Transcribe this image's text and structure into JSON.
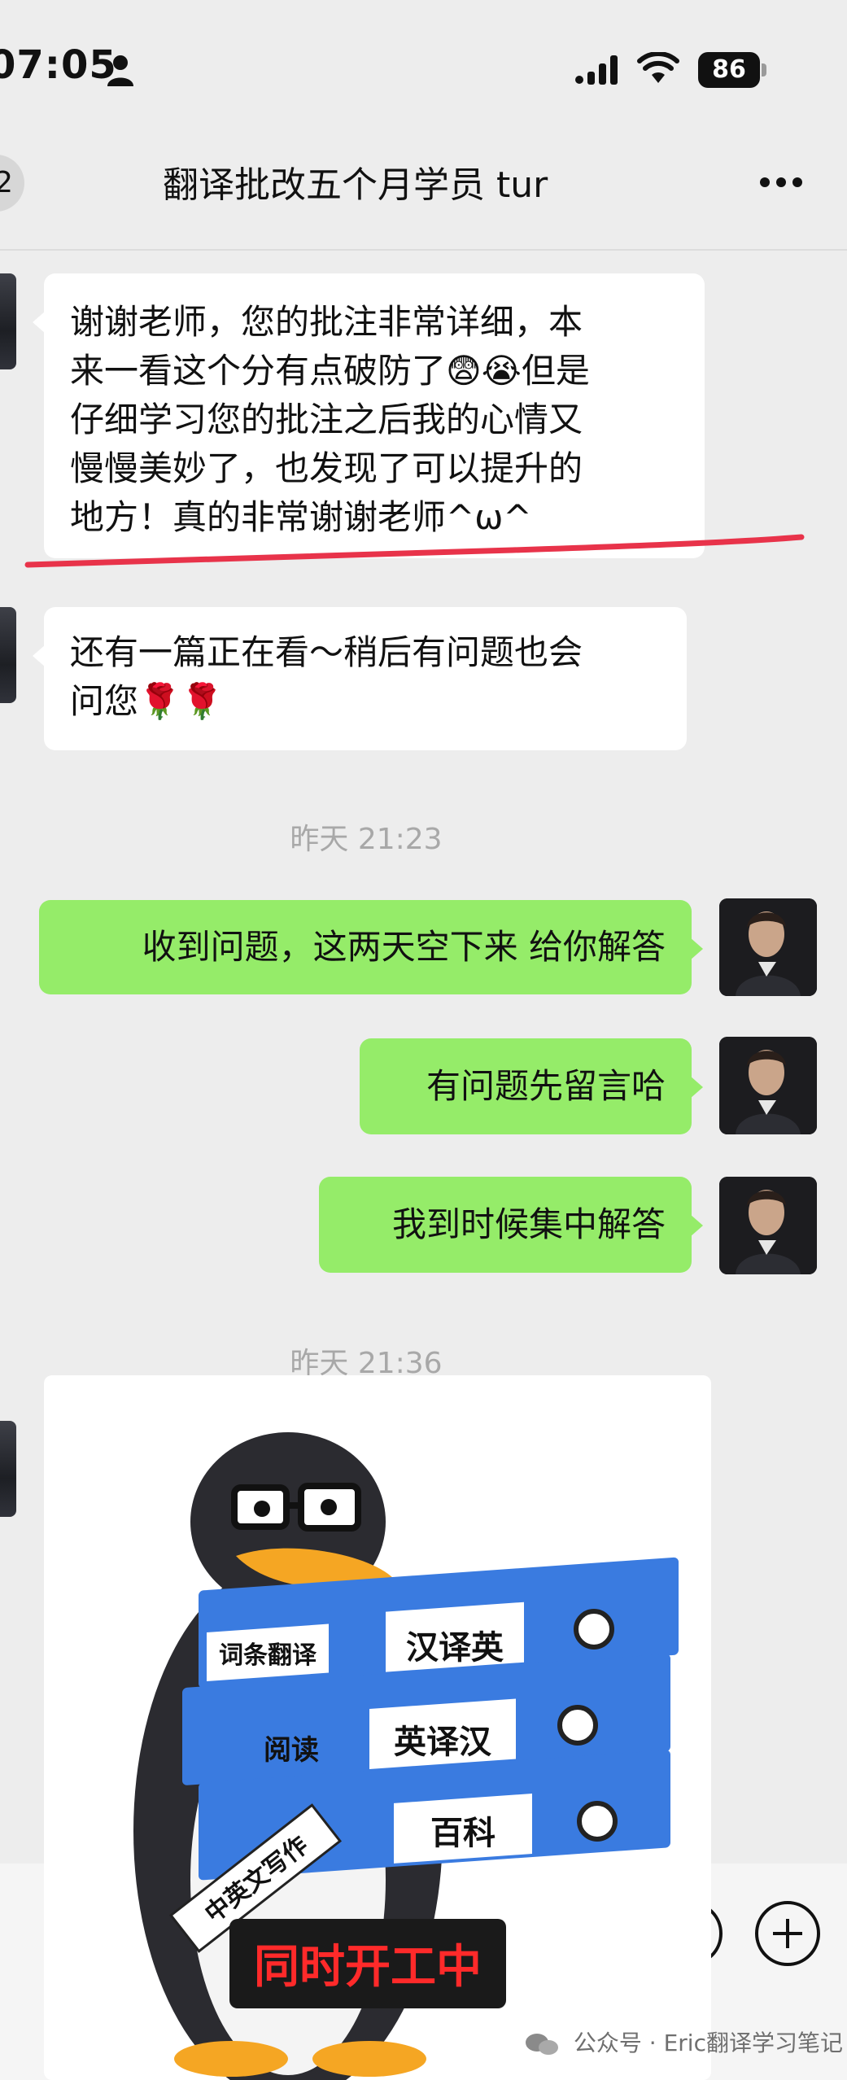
{
  "status_bar": {
    "time": "07:05",
    "battery": "86"
  },
  "header": {
    "back_label": "2",
    "title": "翻译批改五个月学员 tur"
  },
  "messages": [
    {
      "side": "left",
      "lines": [
        "谢谢老师，您的批注非常详细，本",
        "来一看这个分有点破防了😨😭但是",
        "仔细学习您的批注之后我的心情又",
        "慢慢美妙了，也发现了可以提升的",
        "地方！真的非常谢谢老师^ω^"
      ]
    },
    {
      "side": "left",
      "lines": [
        "还有一篇正在看～稍后有问题也会",
        "问您🌹🌹"
      ]
    },
    {
      "side": "right",
      "lines": [
        "收到问题，这两天空下来 给你解答"
      ]
    },
    {
      "side": "right",
      "lines": [
        "有问题先留言哈"
      ]
    },
    {
      "side": "right",
      "lines": [
        "我到时候集中解答"
      ]
    }
  ],
  "timestamps": [
    "昨天 21:23",
    "昨天 21:36"
  ],
  "sticker": {
    "folder_labels": [
      "汉译英",
      "英译汉",
      "百科"
    ],
    "side_labels": [
      "词条翻译",
      "阅读"
    ],
    "ribbon": "中英文写作",
    "banner": "同时开工中"
  },
  "watermark": "公众号 · Eric翻译学习笔记",
  "colors": {
    "background": "#ededed",
    "bubble_self": "#95ec69",
    "bubble_other": "#ffffff",
    "underline": "#e8334a",
    "banner_text": "#ff2a2a",
    "folder_blue": "#3a7be0"
  },
  "icons": [
    "person-icon",
    "signal-icon",
    "wifi-icon",
    "more-icon",
    "emoji-icon",
    "plus-icon"
  ]
}
